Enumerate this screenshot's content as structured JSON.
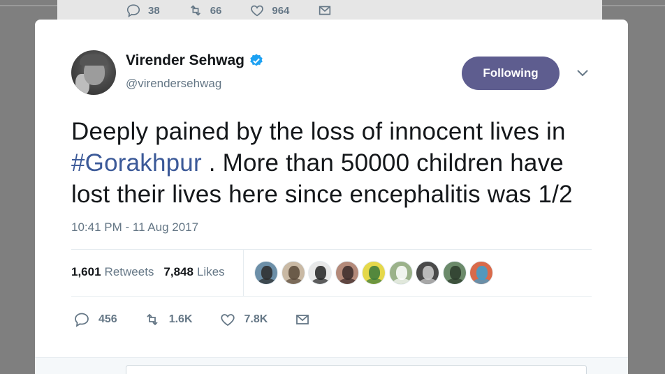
{
  "previous_tweet": {
    "replies": "38",
    "retweets": "66",
    "likes": "964"
  },
  "author": {
    "name": "Virender Sehwag",
    "handle": "@virendersehwag",
    "verified": true
  },
  "follow_button": {
    "label": "Following",
    "color": "#5e5d8f"
  },
  "tweet": {
    "text_before": "Deeply pained by the loss of innocent lives in",
    "hashtag": "#Gorakhpur",
    "text_after": ". More than 50000 children have lost their lives here since encephalitis was 1/2",
    "timestamp": "10:41 PM - 11 Aug 2017"
  },
  "stats": {
    "retweets_count": "1,601",
    "retweets_label": "Retweets",
    "likes_count": "7,848",
    "likes_label": "Likes"
  },
  "liker_avatars": [
    {
      "bg": "#6c8fa8",
      "fg": "#2b2b2b"
    },
    {
      "bg": "#c9b9a4",
      "fg": "#5a4a3a"
    },
    {
      "bg": "#e8e8e8",
      "fg": "#222222"
    },
    {
      "bg": "#b48a7a",
      "fg": "#3a2a2a"
    },
    {
      "bg": "#e5d84a",
      "fg": "#3b7a3b"
    },
    {
      "bg": "#9bb28a",
      "fg": "#ffffff"
    },
    {
      "bg": "#4a4a4a",
      "fg": "#cfcfcf"
    },
    {
      "bg": "#6b8a6a",
      "fg": "#2b3b2b"
    },
    {
      "bg": "#d96a4a",
      "fg": "#3aa0d0"
    }
  ],
  "actions": {
    "replies": "456",
    "retweets": "1.6K",
    "likes": "7.8K"
  },
  "colors": {
    "text": "#14171a",
    "muted": "#657786",
    "link": "#3b5998",
    "verified": "#1da1f2"
  }
}
